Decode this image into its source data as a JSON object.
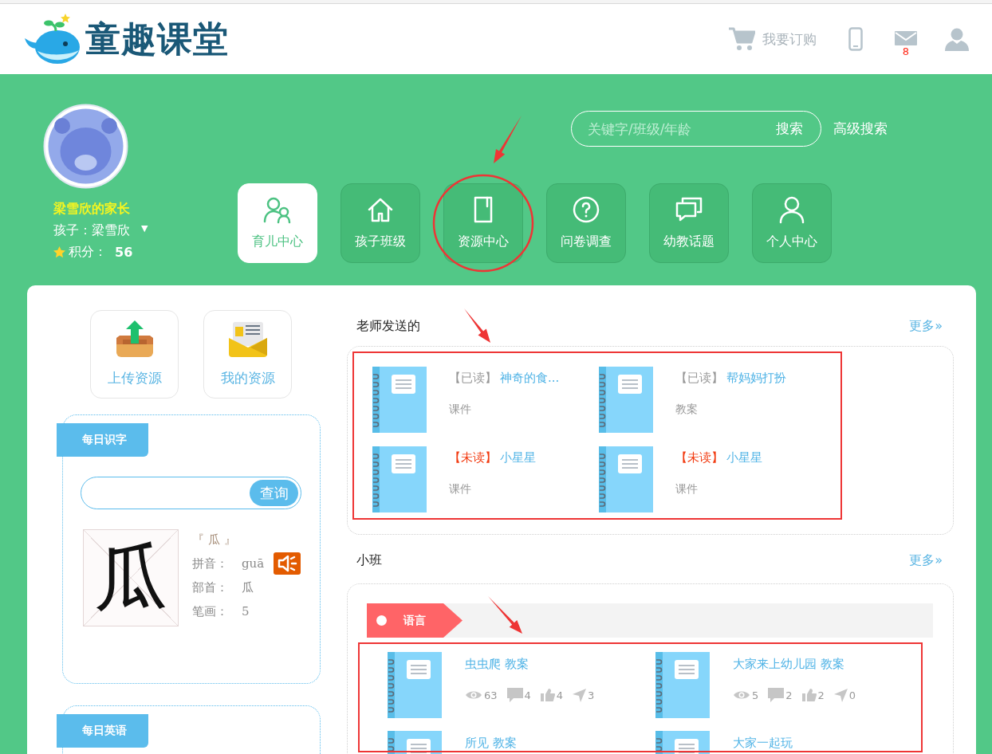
{
  "header": {
    "logo_text": "童趣课堂",
    "order_label": "我要订购",
    "mail_count": "8"
  },
  "profile": {
    "parent_name": "梁雪欣的家长",
    "child_label": "孩子：梁雪欣",
    "dropdown": "▼",
    "points_label": "积分：",
    "points": "56"
  },
  "search": {
    "placeholder": "关键字/班级/年龄",
    "button": "搜索",
    "advanced_link": "高级搜索"
  },
  "nav": [
    {
      "label": "育儿中心",
      "selected": true,
      "marked": false
    },
    {
      "label": "孩子班级",
      "selected": false,
      "marked": false
    },
    {
      "label": "资源中心",
      "selected": false,
      "marked": true
    },
    {
      "label": "问卷调查",
      "selected": false,
      "marked": false
    },
    {
      "label": "幼教话题",
      "selected": false,
      "marked": false
    },
    {
      "label": "个人中心",
      "selected": false,
      "marked": false
    }
  ],
  "resource_buttons": [
    {
      "label": "上传资源"
    },
    {
      "label": "我的资源"
    }
  ],
  "daily_character": {
    "title": "每日识字",
    "search_button": "查询",
    "glyph": "瓜",
    "heading": "『 瓜 』",
    "fields": [
      {
        "label": "拼音：",
        "value": "guā"
      },
      {
        "label": "部首：",
        "value": "瓜"
      },
      {
        "label": "笔画：",
        "value": "5"
      }
    ]
  },
  "daily_english": {
    "title": "每日英语"
  },
  "teacher_sent": {
    "title": "老师发送的",
    "more": "更多»",
    "marked": true,
    "items": [
      {
        "status": "【已读】",
        "read": true,
        "title": "神奇的食...",
        "type": "课件"
      },
      {
        "status": "【已读】",
        "read": true,
        "title": "帮妈妈打扮",
        "type": "教案"
      },
      {
        "status": "【未读】",
        "read": false,
        "title": "小星星",
        "type": "课件"
      },
      {
        "status": "【未读】",
        "read": false,
        "title": "小星星",
        "type": "课件"
      }
    ]
  },
  "class_section": {
    "title": "小班",
    "more": "更多»",
    "category": "语言",
    "marked": true,
    "items": [
      {
        "title": "虫虫爬 教案",
        "stats": [
          {
            "kind": "views",
            "value": "63"
          },
          {
            "kind": "comments",
            "value": "4"
          },
          {
            "kind": "likes",
            "value": "4"
          },
          {
            "kind": "shares",
            "value": "3"
          }
        ]
      },
      {
        "title": "大家来上幼儿园 教案",
        "stats": [
          {
            "kind": "views",
            "value": "5"
          },
          {
            "kind": "comments",
            "value": "2"
          },
          {
            "kind": "likes",
            "value": "2"
          },
          {
            "kind": "shares",
            "value": "0"
          }
        ]
      },
      {
        "title": "所见 教案"
      },
      {
        "title": "大家一起玩"
      }
    ]
  }
}
